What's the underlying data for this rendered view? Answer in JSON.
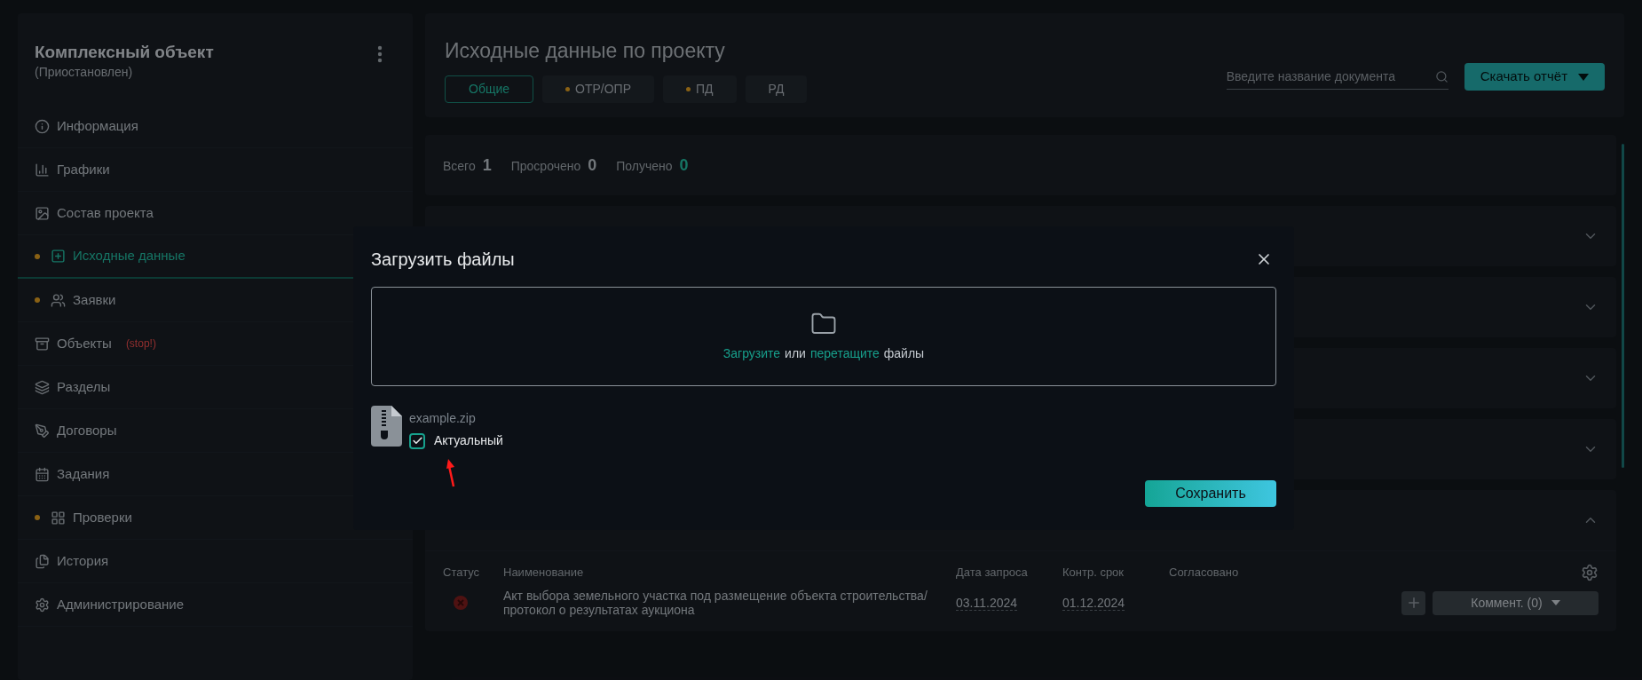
{
  "sidebar": {
    "title": "Комплексный объект",
    "subtitle": "(Приостановлен)",
    "items": [
      {
        "label": "Информация",
        "dot": false,
        "selected": false
      },
      {
        "label": "Графики",
        "dot": false,
        "selected": false
      },
      {
        "label": "Состав проекта",
        "dot": false,
        "selected": false
      },
      {
        "label": "Исходные данные",
        "dot": true,
        "selected": true
      },
      {
        "label": "Заявки",
        "dot": true,
        "selected": false
      },
      {
        "label": "Объекты",
        "dot": false,
        "selected": false,
        "badge": "(stop!)"
      },
      {
        "label": "Разделы",
        "dot": false,
        "selected": false
      },
      {
        "label": "Договоры",
        "dot": false,
        "selected": false
      },
      {
        "label": "Задания",
        "dot": false,
        "selected": false
      },
      {
        "label": "Проверки",
        "dot": true,
        "selected": false
      },
      {
        "label": "История",
        "dot": false,
        "selected": false
      },
      {
        "label": "Администрирование",
        "dot": false,
        "selected": false
      }
    ]
  },
  "header": {
    "title": "Исходные данные по проекту",
    "tabs": [
      {
        "label": "Общие",
        "selected": true,
        "dot": false
      },
      {
        "label": "ОТР/ОПР",
        "selected": false,
        "dot": true
      },
      {
        "label": "ПД",
        "selected": false,
        "dot": true
      },
      {
        "label": "РД",
        "selected": false,
        "dot": false
      }
    ],
    "search": {
      "placeholder": "Введите название документа"
    },
    "download_button": "Скачать отчёт"
  },
  "stats": [
    {
      "label": "Всего",
      "value": "1",
      "accent": false
    },
    {
      "label": "Просрочено",
      "value": "0",
      "accent": false
    },
    {
      "label": "Получено",
      "value": "0",
      "accent": true
    }
  ],
  "sections": [
    {
      "expanded": false
    },
    {
      "expanded": false
    },
    {
      "expanded": false
    },
    {
      "expanded": false
    },
    {
      "expanded": true
    }
  ],
  "table": {
    "columns": [
      "Статус",
      "Наименование",
      "Дата запроса",
      "Контр. срок",
      "Согласовано"
    ],
    "rows": [
      {
        "name": "Акт выбора земельного участка под размещение объекта строительства/ протокол о результатах аукциона",
        "request_date": "03.11.2024",
        "deadline": "01.12.2024",
        "comment_button": "Коммент. (0)"
      }
    ]
  },
  "modal": {
    "title": "Загрузить файлы",
    "dropzone": [
      {
        "kind": "link",
        "text": "Загрузите"
      },
      {
        "kind": "text",
        "text": "или"
      },
      {
        "kind": "link",
        "text": "перетащите"
      },
      {
        "kind": "text",
        "text": "файлы"
      }
    ],
    "file": {
      "name": "example.zip",
      "checkbox": {
        "label": "Актуальный",
        "checked": true
      }
    },
    "save_button": "Сохранить"
  }
}
